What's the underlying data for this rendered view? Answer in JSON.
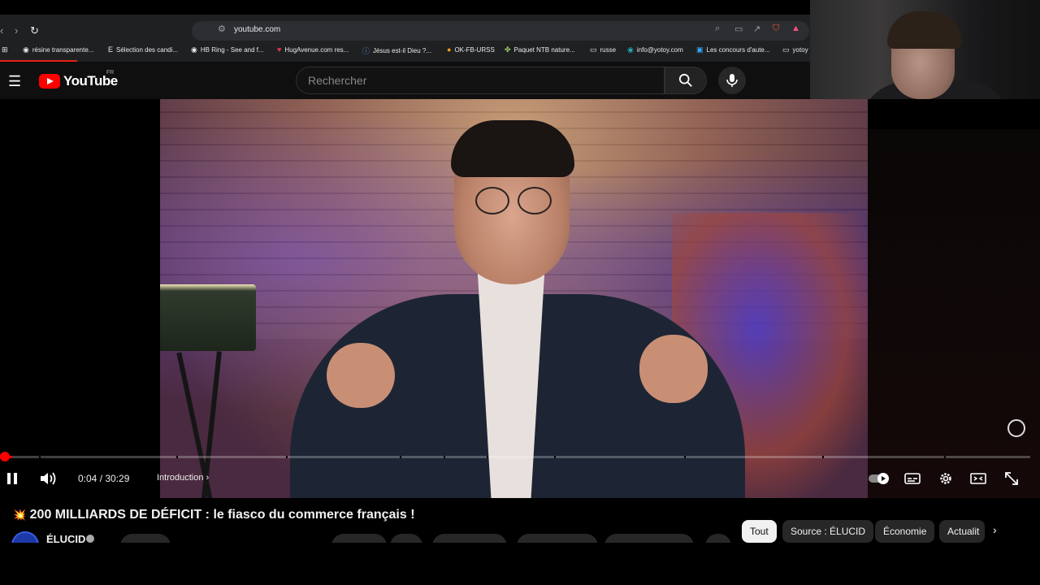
{
  "browser": {
    "url": "youtube.com",
    "bookmarks": [
      {
        "icon": "globe-icon",
        "label": "résine transparente..."
      },
      {
        "icon": "e-icon",
        "label": "Sélection des candi..."
      },
      {
        "icon": "globe-icon",
        "label": "HB Ring - See and f..."
      },
      {
        "icon": "heart-icon",
        "label": "HugAvenue.com res..."
      },
      {
        "icon": "info-icon",
        "label": "Jésus est-il Dieu ?..."
      },
      {
        "icon": "coin-icon",
        "label": "OK-FB-URSS"
      },
      {
        "icon": "plant-icon",
        "label": "Paquet NTB nature..."
      },
      {
        "icon": "folder-icon",
        "label": "russe"
      },
      {
        "icon": "globe-icon",
        "label": "info@yotoy.com"
      },
      {
        "icon": "globe-icon",
        "label": "Les concours d'aute..."
      },
      {
        "icon": "folder-icon",
        "label": "yotoy"
      }
    ]
  },
  "youtube": {
    "logo_text": "YouTube",
    "country": "FR",
    "search_placeholder": "Rechercher"
  },
  "player": {
    "current_time": "0:04",
    "separator": " / ",
    "duration": "30:29",
    "progress_fraction": 0.002,
    "chapter": "Introduction"
  },
  "video": {
    "title_emoji": "💥",
    "title": "200 MILLIARDS DE DÉFICIT : le fiasco du commerce français !",
    "channel": "ÉLUCID"
  },
  "chips": [
    {
      "label": "Tout",
      "active": true
    },
    {
      "label": "Source : ÉLUCID",
      "active": false
    },
    {
      "label": "Économie",
      "active": false
    },
    {
      "label": "Actualit",
      "active": false
    }
  ],
  "colors": {
    "accent": "#ff0000",
    "background": "#0f0f0f"
  }
}
